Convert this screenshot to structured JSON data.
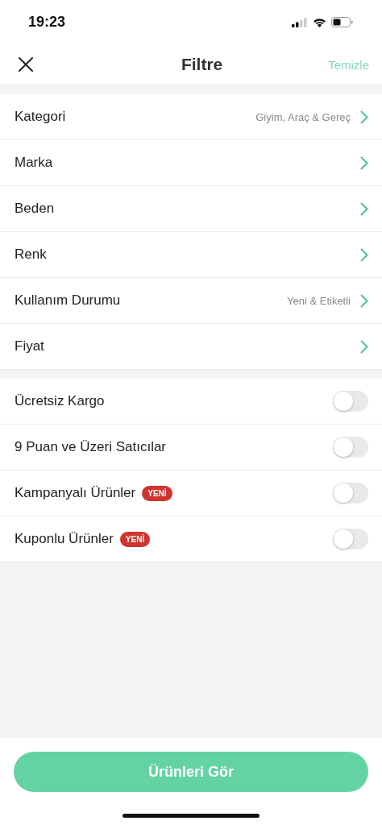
{
  "status_bar": {
    "time": "19:23"
  },
  "nav": {
    "title": "Filtre",
    "action": "Temizle"
  },
  "filters": [
    {
      "label": "Kategori",
      "value": "Giyim, Araç & Gereç"
    },
    {
      "label": "Marka"
    },
    {
      "label": "Beden"
    },
    {
      "label": "Renk"
    },
    {
      "label": "Kullanım Durumu",
      "value": "Yeni & Etiketli"
    },
    {
      "label": "Fiyat"
    }
  ],
  "toggles": [
    {
      "label": "Ücretsiz Kargo",
      "on": false
    },
    {
      "label": "9 Puan ve Üzeri Satıcılar",
      "on": false
    },
    {
      "label": "Kampanyalı Ürünler",
      "badge": "YENİ",
      "on": false
    },
    {
      "label": "Kuponlu Ürünler",
      "badge": "YENİ",
      "on": false
    }
  ],
  "footer": {
    "button": "Ürünleri Gör"
  }
}
